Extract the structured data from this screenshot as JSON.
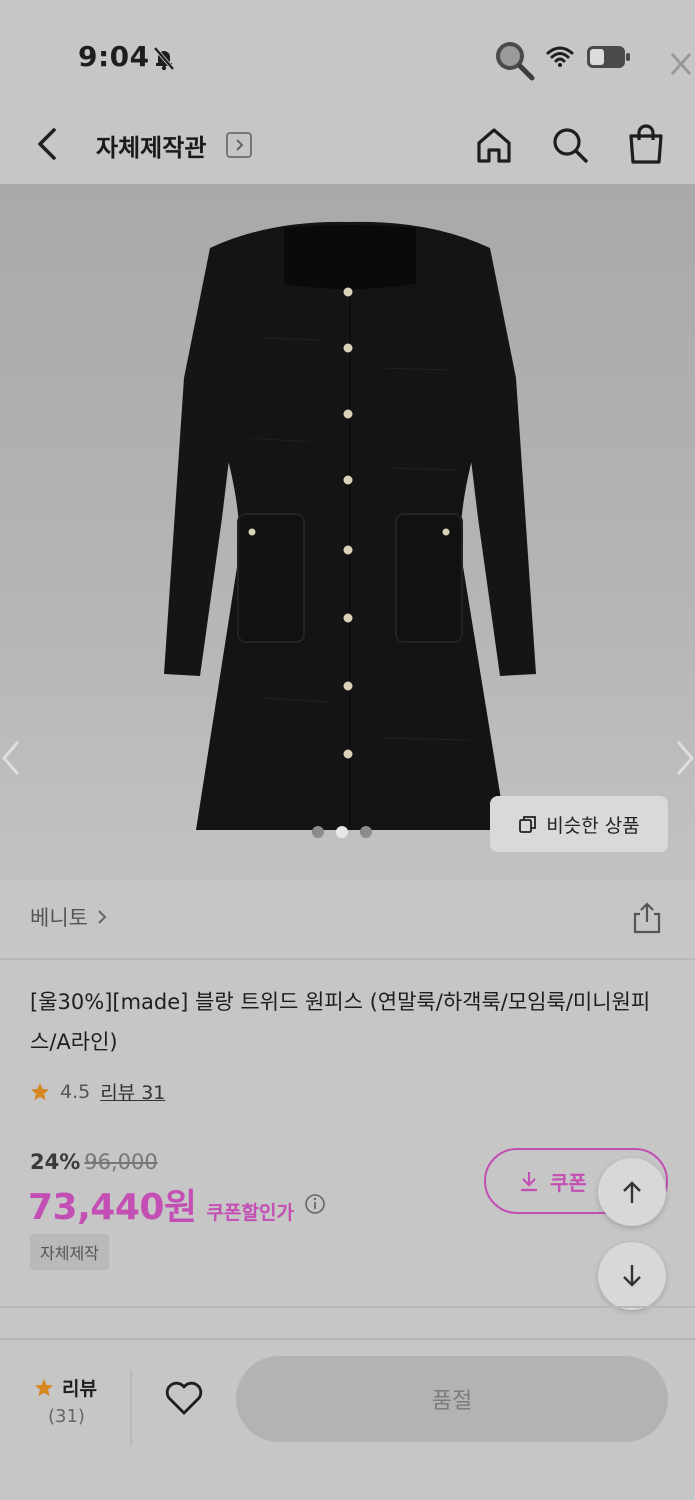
{
  "status_bar": {
    "time": "9:04"
  },
  "header": {
    "title": "자체제작관"
  },
  "hero": {
    "similar_label": "비슷한 상품",
    "carousel": {
      "count": 3,
      "active": 1
    }
  },
  "product": {
    "brand": "베니토",
    "title": "[울30%][made] 블랑 트위드 원피스 (연말룩/하객룩/모임룩/미니원피스/A라인)",
    "rating": "4.5",
    "review_link": "리뷰 31",
    "discount_pct": "24%",
    "original_price": "96,000",
    "price": "73,440원",
    "coupon_price_label": "쿠폰할인가",
    "tag": "자체제작",
    "coupon_button": "쿠폰"
  },
  "bottom_bar": {
    "review_label": "리뷰",
    "review_count": "(31)",
    "soldout_label": "품절"
  },
  "icons": {
    "star": "star-icon",
    "heart": "heart-icon",
    "home": "home-icon",
    "search": "search-icon",
    "cart": "shopping-bag-icon"
  },
  "colors": {
    "accent": "#c34eb4",
    "star": "#d6871f"
  }
}
